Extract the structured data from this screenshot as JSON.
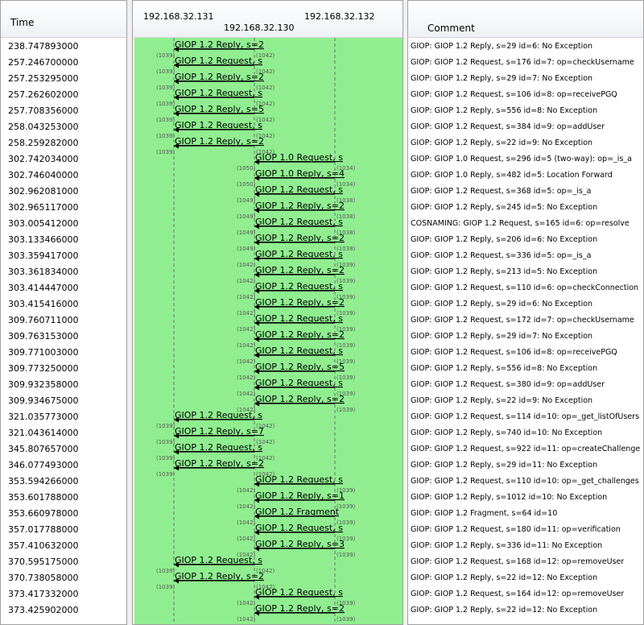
{
  "headers": {
    "time": "Time",
    "comment": "Comment",
    "nodes": [
      "192.168.32.131",
      "192.168.32.130",
      "192.168.32.132"
    ]
  },
  "rows": [
    {
      "time": "238.747893000",
      "from": 0,
      "to": 1,
      "label": "GIOP 1.2 Reply, s=2",
      "src_port": "(1039)",
      "dst_port": "(1042)",
      "comment": "GIOP: GIOP 1.2 Reply, s=29 id=6: No Exception"
    },
    {
      "time": "257.246700000",
      "from": 0,
      "to": 1,
      "label": "GIOP 1.2 Request, s",
      "src_port": "(1039)",
      "dst_port": "(1042)",
      "comment": "GIOP: GIOP 1.2 Request, s=176 id=7: op=checkUsername"
    },
    {
      "time": "257.253295000",
      "from": 0,
      "to": 1,
      "label": "GIOP 1.2 Reply, s=2",
      "src_port": "(1039)",
      "dst_port": "(1042)",
      "comment": "GIOP: GIOP 1.2 Reply, s=29 id=7: No Exception"
    },
    {
      "time": "257.262602000",
      "from": 0,
      "to": 1,
      "label": "GIOP 1.2 Request, s",
      "src_port": "(1039)",
      "dst_port": "(1042)",
      "comment": "GIOP: GIOP 1.2 Request, s=106 id=8: op=receivePGQ"
    },
    {
      "time": "257.708356000",
      "from": 0,
      "to": 1,
      "label": "GIOP 1.2 Reply, s=5",
      "src_port": "(1039)",
      "dst_port": "(1042)",
      "comment": "GIOP: GIOP 1.2 Reply, s=556 id=8: No Exception"
    },
    {
      "time": "258.043253000",
      "from": 0,
      "to": 1,
      "label": "GIOP 1.2 Request, s",
      "src_port": "(1039)",
      "dst_port": "(1042)",
      "comment": "GIOP: GIOP 1.2 Request, s=384 id=9: op=addUser"
    },
    {
      "time": "258.259282000",
      "from": 0,
      "to": 1,
      "label": "GIOP 1.2 Reply, s=2",
      "src_port": "(1039)",
      "dst_port": "(1042)",
      "comment": "GIOP: GIOP 1.2 Reply, s=22 id=9: No Exception"
    },
    {
      "time": "302.742034000",
      "from": 1,
      "to": 2,
      "label": "GIOP 1.0 Request, s",
      "src_port": "(1050)",
      "dst_port": "(1034)",
      "comment": "GIOP: GIOP 1.0 Request, s=296 id=5 (two-way): op=_is_a"
    },
    {
      "time": "302.746040000",
      "from": 1,
      "to": 2,
      "label": "GIOP 1.0 Reply, s=4",
      "src_port": "(1050)",
      "dst_port": "(1034)",
      "comment": "GIOP: GIOP 1.0 Reply, s=482 id=5: Location Forward"
    },
    {
      "time": "302.962081000",
      "from": 1,
      "to": 2,
      "label": "GIOP 1.2 Request, s",
      "src_port": "(1049)",
      "dst_port": "(1038)",
      "comment": "GIOP: GIOP 1.2 Request, s=368 id=5: op=_is_a"
    },
    {
      "time": "302.965117000",
      "from": 1,
      "to": 2,
      "label": "GIOP 1.2 Reply, s=2",
      "src_port": "(1049)",
      "dst_port": "(1038)",
      "comment": "GIOP: GIOP 1.2 Reply, s=245 id=5: No Exception"
    },
    {
      "time": "303.005412000",
      "from": 1,
      "to": 2,
      "label": "GIOP 1.2 Request, s",
      "src_port": "(1049)",
      "dst_port": "(1038)",
      "comment": "COSNAMING: GIOP 1.2 Request, s=165 id=6: op=resolve"
    },
    {
      "time": "303.133466000",
      "from": 1,
      "to": 2,
      "label": "GIOP 1.2 Reply, s=2",
      "src_port": "(1049)",
      "dst_port": "(1038)",
      "comment": "GIOP: GIOP 1.2 Reply, s=206 id=6: No Exception"
    },
    {
      "time": "303.359417000",
      "from": 1,
      "to": 2,
      "label": "GIOP 1.2 Request, s",
      "src_port": "(1042)",
      "dst_port": "(1039)",
      "comment": "GIOP: GIOP 1.2 Request, s=336 id=5: op=_is_a"
    },
    {
      "time": "303.361834000",
      "from": 1,
      "to": 2,
      "label": "GIOP 1.2 Reply, s=2",
      "src_port": "(1042)",
      "dst_port": "(1039)",
      "comment": "GIOP: GIOP 1.2 Reply, s=213 id=5: No Exception"
    },
    {
      "time": "303.414447000",
      "from": 1,
      "to": 2,
      "label": "GIOP 1.2 Request, s",
      "src_port": "(1042)",
      "dst_port": "(1039)",
      "comment": "GIOP: GIOP 1.2 Request, s=110 id=6: op=checkConnection"
    },
    {
      "time": "303.415416000",
      "from": 1,
      "to": 2,
      "label": "GIOP 1.2 Reply, s=2",
      "src_port": "(1042)",
      "dst_port": "(1039)",
      "comment": "GIOP: GIOP 1.2 Reply, s=29 id=6: No Exception"
    },
    {
      "time": "309.760711000",
      "from": 1,
      "to": 2,
      "label": "GIOP 1.2 Request, s",
      "src_port": "(1042)",
      "dst_port": "(1039)",
      "comment": "GIOP: GIOP 1.2 Request, s=172 id=7: op=checkUsername"
    },
    {
      "time": "309.763153000",
      "from": 1,
      "to": 2,
      "label": "GIOP 1.2 Reply, s=2",
      "src_port": "(1042)",
      "dst_port": "(1039)",
      "comment": "GIOP: GIOP 1.2 Reply, s=29 id=7: No Exception"
    },
    {
      "time": "309.771003000",
      "from": 1,
      "to": 2,
      "label": "GIOP 1.2 Request, s",
      "src_port": "(1042)",
      "dst_port": "(1039)",
      "comment": "GIOP: GIOP 1.2 Request, s=106 id=8: op=receivePGQ"
    },
    {
      "time": "309.773250000",
      "from": 1,
      "to": 2,
      "label": "GIOP 1.2 Reply, s=5",
      "src_port": "(1042)",
      "dst_port": "(1039)",
      "comment": "GIOP: GIOP 1.2 Reply, s=556 id=8: No Exception"
    },
    {
      "time": "309.932358000",
      "from": 1,
      "to": 2,
      "label": "GIOP 1.2 Request, s",
      "src_port": "(1042)",
      "dst_port": "(1039)",
      "comment": "GIOP: GIOP 1.2 Request, s=380 id=9: op=addUser"
    },
    {
      "time": "309.934675000",
      "from": 1,
      "to": 2,
      "label": "GIOP 1.2 Reply, s=2",
      "src_port": "(1042)",
      "dst_port": "(1039)",
      "comment": "GIOP: GIOP 1.2 Reply, s=22 id=9: No Exception"
    },
    {
      "time": "321.035773000",
      "from": 0,
      "to": 1,
      "label": "GIOP 1.2 Request, s",
      "src_port": "(1039)",
      "dst_port": "(1042)",
      "comment": "GIOP: GIOP 1.2 Request, s=114 id=10: op=_get_listOfUsers"
    },
    {
      "time": "321.043614000",
      "from": 0,
      "to": 1,
      "label": "GIOP 1.2 Reply, s=7",
      "src_port": "(1039)",
      "dst_port": "(1042)",
      "comment": "GIOP: GIOP 1.2 Reply, s=740 id=10: No Exception"
    },
    {
      "time": "345.807657000",
      "from": 0,
      "to": 1,
      "label": "GIOP 1.2 Request, s",
      "src_port": "(1039)",
      "dst_port": "(1042)",
      "comment": "GIOP: GIOP 1.2 Request, s=922 id=11: op=createChallenge"
    },
    {
      "time": "346.077493000",
      "from": 0,
      "to": 1,
      "label": "GIOP 1.2 Reply, s=2",
      "src_port": "(1039)",
      "dst_port": "(1042)",
      "comment": "GIOP: GIOP 1.2 Reply, s=29 id=11: No Exception"
    },
    {
      "time": "353.594266000",
      "from": 1,
      "to": 2,
      "label": "GIOP 1.2 Request, s",
      "src_port": "(1042)",
      "dst_port": "(1039)",
      "comment": "GIOP: GIOP 1.2 Request, s=110 id=10: op=_get_challenges"
    },
    {
      "time": "353.601788000",
      "from": 1,
      "to": 2,
      "label": "GIOP 1.2 Reply, s=1",
      "src_port": "(1042)",
      "dst_port": "(1039)",
      "comment": "GIOP: GIOP 1.2 Reply, s=1012 id=10: No Exception"
    },
    {
      "time": "353.660978000",
      "from": 1,
      "to": 2,
      "label": "GIOP 1.2 Fragment",
      "src_port": "(1042)",
      "dst_port": "(1039)",
      "comment": "GIOP: GIOP 1.2 Fragment, s=64 id=10"
    },
    {
      "time": "357.017788000",
      "from": 1,
      "to": 2,
      "label": "GIOP 1.2 Request, s",
      "src_port": "(1042)",
      "dst_port": "(1039)",
      "comment": "GIOP: GIOP 1.2 Request, s=180 id=11: op=verification"
    },
    {
      "time": "357.410632000",
      "from": 1,
      "to": 2,
      "label": "GIOP 1.2 Reply, s=3",
      "src_port": "(1042)",
      "dst_port": "(1039)",
      "comment": "GIOP: GIOP 1.2 Reply, s=336 id=11: No Exception"
    },
    {
      "time": "370.595175000",
      "from": 0,
      "to": 1,
      "label": "GIOP 1.2 Request, s",
      "src_port": "(1039)",
      "dst_port": "(1042)",
      "comment": "GIOP: GIOP 1.2 Request, s=168 id=12: op=removeUser"
    },
    {
      "time": "370.738058000",
      "from": 0,
      "to": 1,
      "label": "GIOP 1.2 Reply, s=2",
      "src_port": "(1039)",
      "dst_port": "(1042)",
      "comment": "GIOP: GIOP 1.2 Reply, s=22 id=12: No Exception"
    },
    {
      "time": "373.417332000",
      "from": 1,
      "to": 2,
      "label": "GIOP 1.2 Request, s",
      "src_port": "(1042)",
      "dst_port": "(1039)",
      "comment": "GIOP: GIOP 1.2 Request, s=164 id=12: op=removeUser"
    },
    {
      "time": "373.425902000",
      "from": 1,
      "to": 2,
      "label": "GIOP 1.2 Reply, s=2",
      "src_port": "(1042)",
      "dst_port": "(1039)",
      "comment": "GIOP: GIOP 1.2 Reply, s=22 id=12: No Exception"
    }
  ],
  "colors": {
    "graph_bg": "#90ee90",
    "lifeline": "#6f6f6f",
    "arrow": "#000000"
  }
}
